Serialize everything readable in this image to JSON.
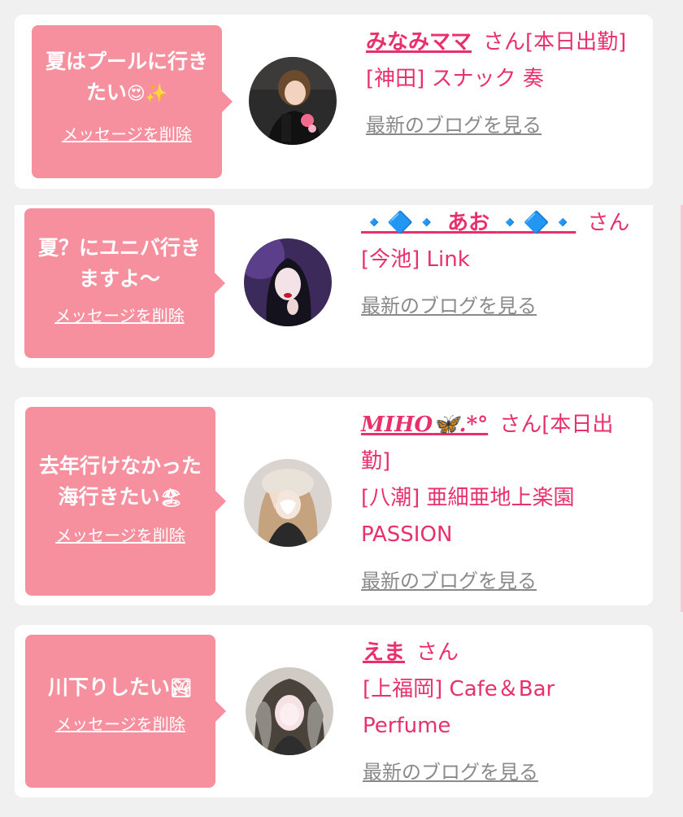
{
  "messages": [
    {
      "bubble_text": "夏はプールに行きたい",
      "bubble_emoji": "😍✨",
      "delete_label": "メッセージを削除",
      "name": "みなみママ",
      "honorific": "さん",
      "status": "[本日出勤]",
      "shop": "[神田] スナック 奏",
      "blog_label": "最新のブログを見る"
    },
    {
      "bubble_text": "夏？にユニバ行きますよ〜",
      "bubble_emoji": "",
      "delete_label": "メッセージを削除",
      "name_prefix": "🔹🔷🔹",
      "name": " あお ",
      "name_suffix": "🔹🔷🔹",
      "honorific": "さん",
      "shop": "[今池] Link",
      "blog_label": "最新のブログを見る"
    },
    {
      "bubble_text": "去年行けなかった海行きたい",
      "bubble_emoji": "🏖",
      "delete_label": "メッセージを削除",
      "name": "MIHO",
      "name_suffix": "🦋.*°",
      "honorific": "さん",
      "status": "[本日出勤]",
      "shop": "[八潮] 亜細亜地上楽園PASSION",
      "blog_label": "最新のブログを見る"
    },
    {
      "bubble_text": "川下りしたい",
      "bubble_emoji": "🏞",
      "delete_label": "メッセージを削除",
      "name": "えま",
      "honorific": "さん",
      "shop": "[上福岡] Cafe＆Bar Perfume",
      "blog_label": "最新のブログを見る"
    }
  ],
  "colors": {
    "bubble": "#f7909e",
    "accent": "#e8306b",
    "link_gray": "#8a8a8a",
    "card": "#ffffff",
    "background": "#f0f0f0"
  }
}
